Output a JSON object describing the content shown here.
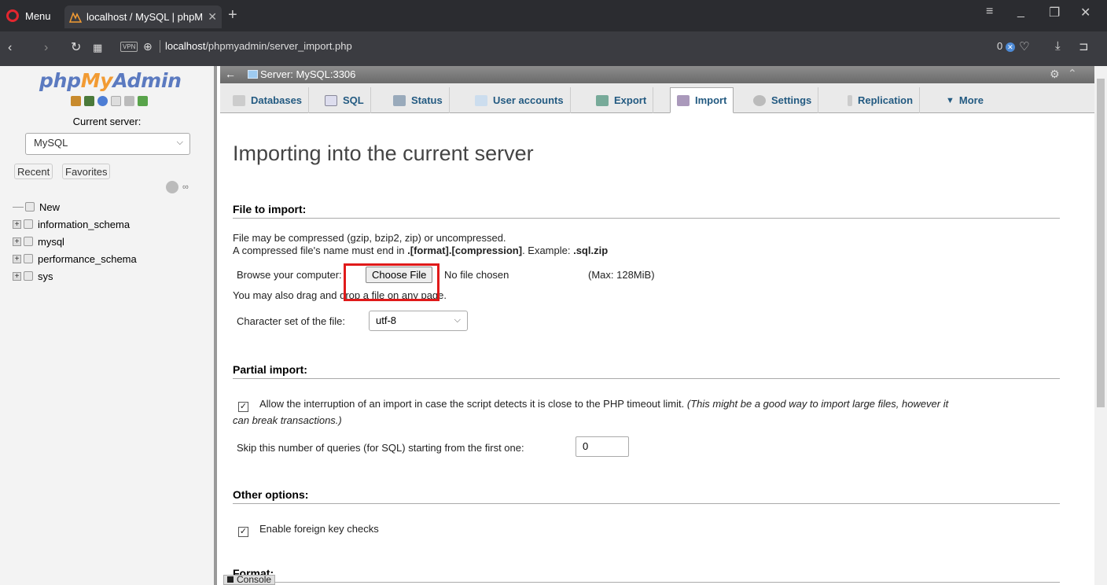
{
  "browser": {
    "menu_label": "Menu",
    "tab_title": "localhost / MySQL | phpM",
    "new_tab": "+",
    "url_host": "localhost",
    "url_path": "/phpmyadmin/server_import.php",
    "vpn_label": "VPN",
    "blocked_count": "0"
  },
  "sidebar": {
    "logo_php": "php",
    "logo_my": "My",
    "logo_admin": "Admin",
    "current_server_label": "Current server:",
    "server_select_value": "MySQL",
    "recent_label": "Recent",
    "favorites_label": "Favorites",
    "databases": [
      {
        "name": "New"
      },
      {
        "name": "information_schema"
      },
      {
        "name": "mysql"
      },
      {
        "name": "performance_schema"
      },
      {
        "name": "sys"
      }
    ]
  },
  "server_bar": {
    "title": "Server: MySQL:3306"
  },
  "tabs": [
    {
      "label": "Databases"
    },
    {
      "label": "SQL"
    },
    {
      "label": "Status"
    },
    {
      "label": "User accounts"
    },
    {
      "label": "Export"
    },
    {
      "label": "Import"
    },
    {
      "label": "Settings"
    },
    {
      "label": "Replication"
    },
    {
      "label": "More"
    }
  ],
  "main": {
    "page_title": "Importing into the current server",
    "file_section_title": "File to import:",
    "compress_note_1": "File may be compressed (gzip, bzip2, zip) or uncompressed.",
    "compress_note_2a": "A compressed file's name must end in ",
    "compress_note_2b": ".[format].[compression]",
    "compress_note_2c": ". Example: ",
    "compress_note_2d": ".sql.zip",
    "browse_label": "Browse your computer:",
    "choose_file_label": "Choose File",
    "no_file_label": "No file chosen",
    "max_label": "(Max: 128MiB)",
    "drag_note": "You may also drag and drop a file on any page.",
    "charset_label": "Character set of the file:",
    "charset_value": "utf-8",
    "partial_section_title": "Partial import:",
    "allow_interrupt_text": "Allow the interruption of an import in case the script detects it is close to the PHP timeout limit.",
    "allow_interrupt_note_1": "(This might be a good way to import large files, however it",
    "allow_interrupt_note_2": "can break transactions.)",
    "skip_label": "Skip this number of queries (for SQL) starting from the first one:",
    "skip_value": "0",
    "other_section_title": "Other options:",
    "fk_label": "Enable foreign key checks",
    "format_section_title": "Format:"
  },
  "console_label": "Console"
}
